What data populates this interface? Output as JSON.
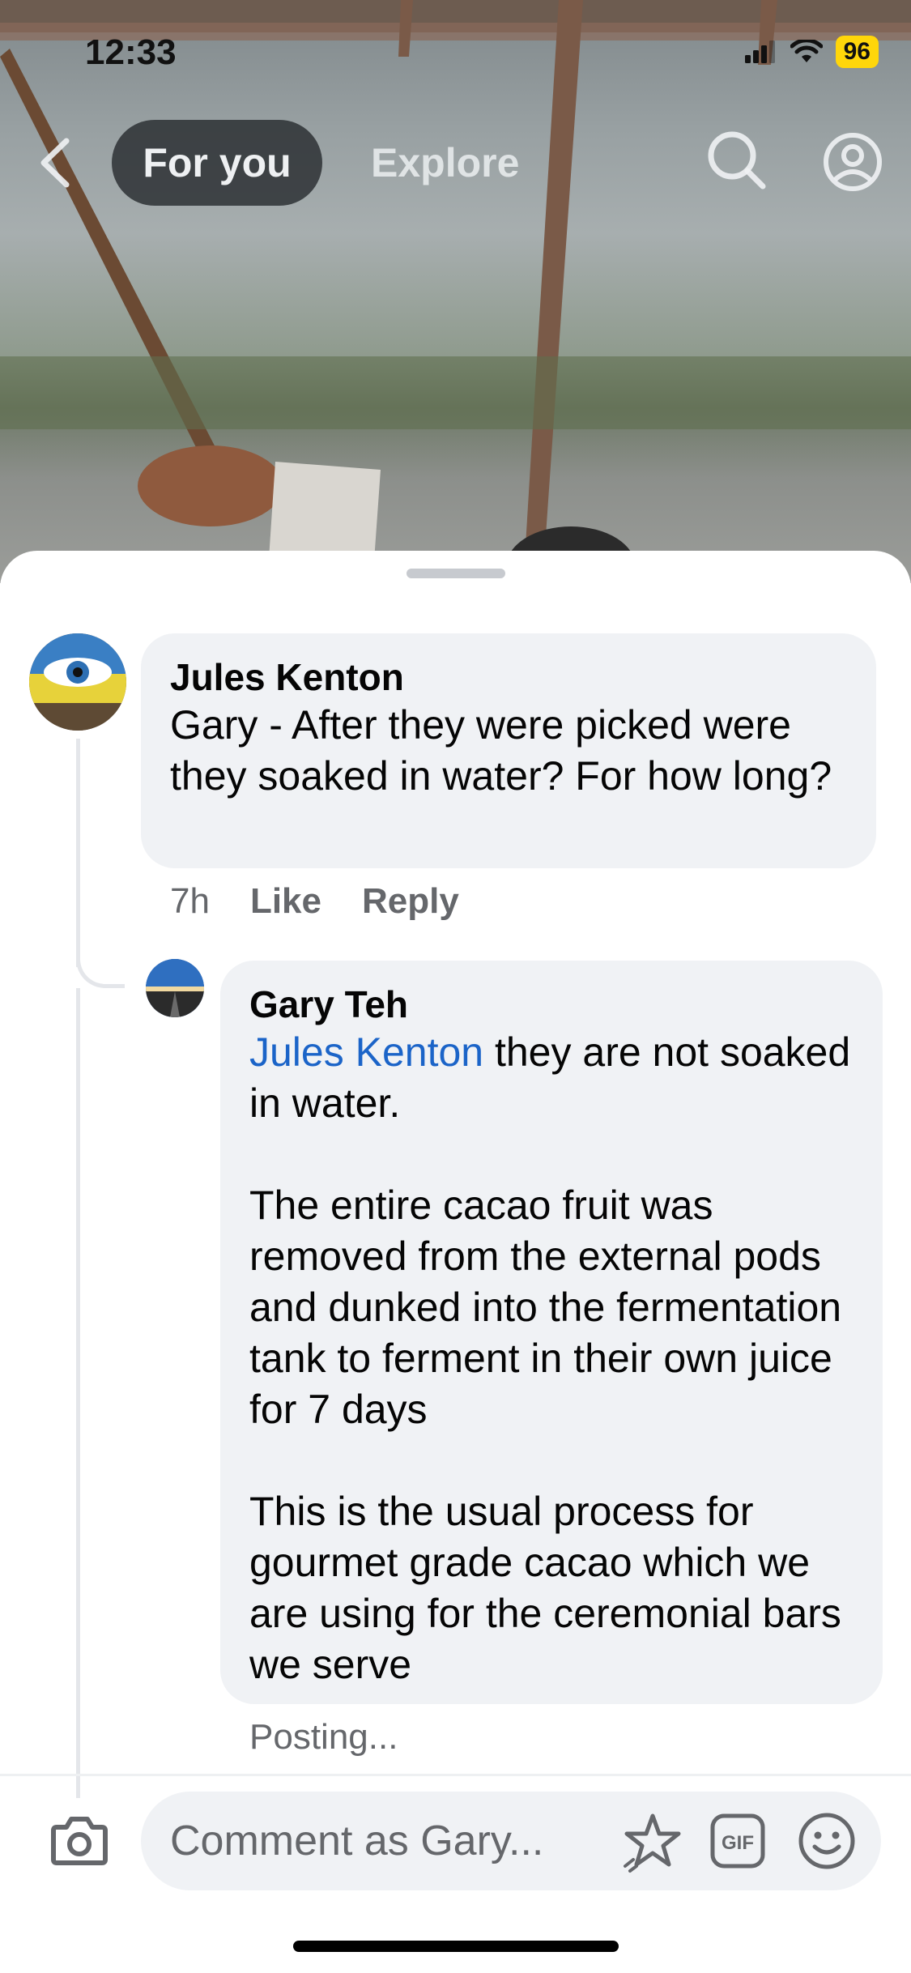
{
  "status_bar": {
    "time": "12:33",
    "battery": "96"
  },
  "nav": {
    "tab_for_you": "For you",
    "tab_explore": "Explore"
  },
  "comments": [
    {
      "author": "Jules Kenton",
      "text": "Gary - After they were picked were they soaked in water?   For how long?",
      "time": "7h",
      "like_label": "Like",
      "reply_label": "Reply"
    }
  ],
  "reply": {
    "author": "Gary Teh",
    "mention": "Jules Kenton",
    "line1_rest": " they are not soaked in water.",
    "para2": "The entire cacao fruit was removed from the external pods and dunked into the fermentation tank to ferment in their own juice for 7 days",
    "para3": "This is the usual process for gourmet grade cacao which we are using for the ceremonial bars we serve",
    "status": "Posting..."
  },
  "composer": {
    "placeholder": "Comment as Gary..."
  },
  "icons": [
    "back-icon",
    "search-icon",
    "profile-icon",
    "camera-icon",
    "sticker-icon",
    "gif-icon",
    "emoji-icon"
  ]
}
